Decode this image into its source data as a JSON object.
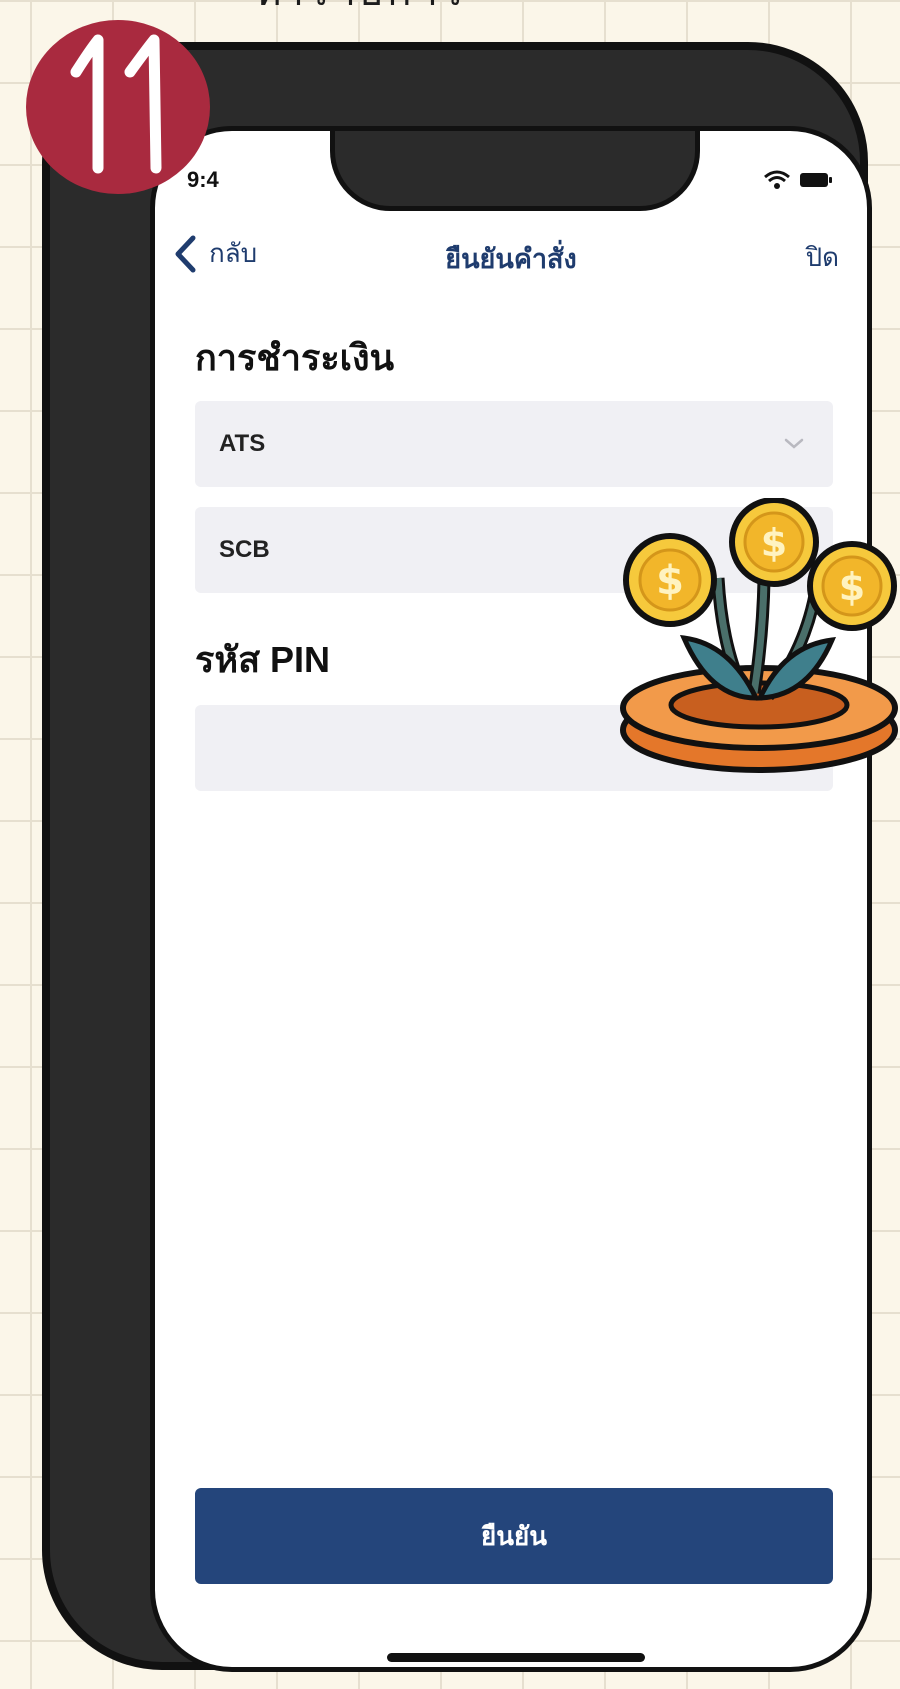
{
  "step_number": "11",
  "top_caption_partial": "ทำรายการ",
  "nav": {
    "back_label": "กลับ",
    "title": "ยืนยันคำสั่ง",
    "close_label": "ปิด"
  },
  "payment": {
    "heading": "การชำระเงิน",
    "method_value": "ATS",
    "bank_value": "SCB"
  },
  "pin": {
    "heading": "รหัส PIN",
    "value": "",
    "placeholder": ""
  },
  "confirm_label": "ยืนยัน",
  "colors": {
    "accent": "#24457b",
    "nav_text": "#1f3c6e",
    "badge": "#a92a3f",
    "field_bg": "#f0f0f4",
    "paper": "#fbf6e9"
  },
  "icons": [
    "step-badge-icon",
    "coin-plant-icon",
    "back-chevron-icon",
    "chevron-down-icon",
    "wifi-icon",
    "battery-icon"
  ]
}
